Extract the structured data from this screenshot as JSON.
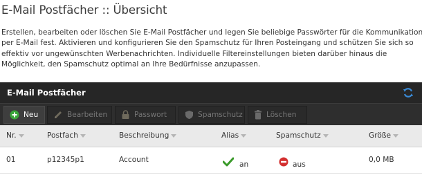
{
  "page": {
    "title": "E-Mail Postfächer :: Übersicht",
    "description_lines": [
      "Erstellen, bearbeiten oder löschen Sie E-Mail Postfächer und legen Sie beliebige Passwörter für die Kommunikation",
      "per E-Mail fest. Aktivieren und konfigurieren Sie den Spamschutz für Ihren Posteingang und schützen Sie sich so",
      "effektiv vor ungewünschten Werbenachrichten. Individuelle Filtereinstellungen bieten darüber hinaus die",
      "Möglichkeit, den Spamschutz optimal an Ihre Bedürfnisse anzupassen."
    ]
  },
  "panel": {
    "title": "E-Mail Postfächer",
    "refresh_icon": "refresh-icon"
  },
  "toolbar": {
    "new_label": "Neu",
    "edit_label": "Bearbeiten",
    "password_label": "Passwort",
    "spam_label": "Spamschutz",
    "delete_label": "Löschen"
  },
  "table": {
    "columns": [
      "Nr.",
      "Postfach",
      "Beschreibung",
      "Alias",
      "Spamschutz",
      "Größe"
    ],
    "rows": [
      {
        "nr": "01",
        "postfach": "p12345p1",
        "beschreibung": "Account",
        "alias": "an",
        "spamschutz": "aus",
        "groesse": "0,0 MB"
      }
    ]
  },
  "colors": {
    "header_bg": "#262626",
    "toolbar_bg": "#2e2e2e",
    "new_icon": "#3aa63a",
    "check": "#3a9a2a",
    "stop": "#d32f2f",
    "refresh": "#3a8ad6"
  }
}
